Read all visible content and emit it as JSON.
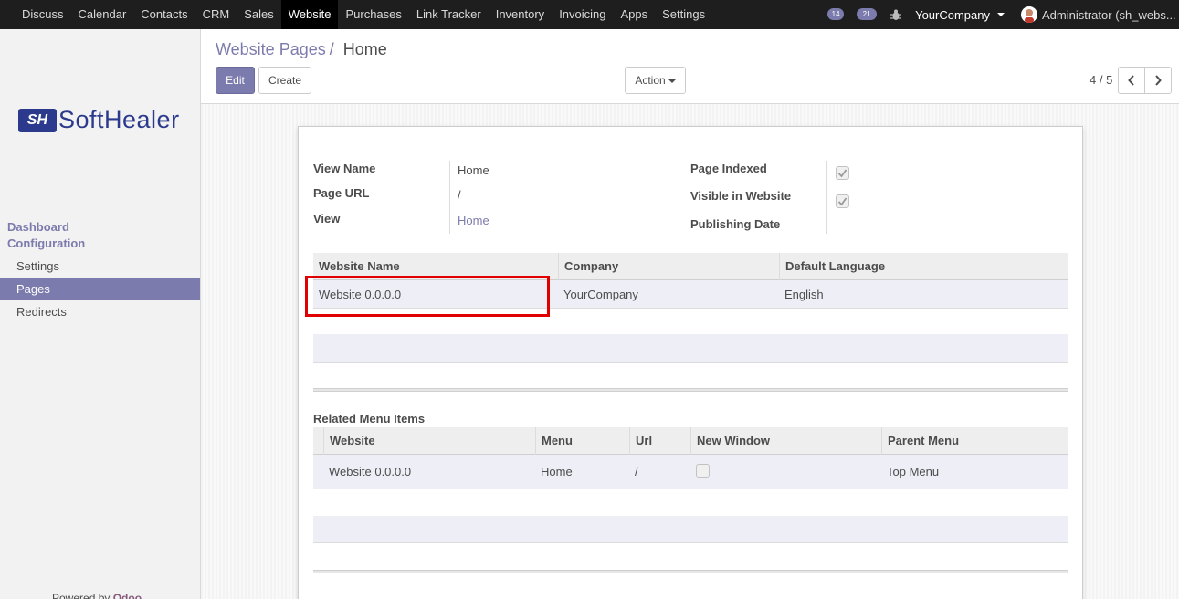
{
  "topbar": {
    "menu": [
      "Discuss",
      "Calendar",
      "Contacts",
      "CRM",
      "Sales",
      "Website",
      "Purchases",
      "Link Tracker",
      "Inventory",
      "Invoicing",
      "Apps",
      "Settings"
    ],
    "active_index": 5,
    "messages_count": "14",
    "activities_count": "21",
    "company": "YourCompany",
    "user": "Administrator (sh_webs..."
  },
  "sidebar": {
    "brand_mark": "SH",
    "brand_name": "SoftHealer",
    "sections": [
      "Dashboard",
      "Configuration"
    ],
    "items": [
      {
        "label": "Settings",
        "active": false
      },
      {
        "label": "Pages",
        "active": true
      },
      {
        "label": "Redirects",
        "active": false
      }
    ],
    "powered_prefix": "Powered by ",
    "powered_brand": "Odoo"
  },
  "control": {
    "breadcrumb_parent": "Website Pages",
    "breadcrumb_current": "Home",
    "edit_label": "Edit",
    "create_label": "Create",
    "action_label": "Action",
    "pager": "4 / 5"
  },
  "form": {
    "view_name_label": "View Name",
    "view_name": "Home",
    "page_url_label": "Page URL",
    "page_url": "/",
    "view_label": "View",
    "view": "Home",
    "page_indexed_label": "Page Indexed",
    "page_indexed": true,
    "visible_label": "Visible in Website",
    "visible": true,
    "publishing_date_label": "Publishing Date",
    "publishing_date": ""
  },
  "website_table": {
    "columns": [
      "Website Name",
      "Company",
      "Default Language"
    ],
    "rows": [
      [
        "Website 0.0.0.0",
        "YourCompany",
        "English"
      ]
    ]
  },
  "menu_table": {
    "title": "Related Menu Items",
    "columns": [
      "Website",
      "Menu",
      "Url",
      "New Window",
      "Parent Menu"
    ],
    "rows": [
      [
        "Website 0.0.0.0",
        "Home",
        "/",
        false,
        "Top Menu"
      ]
    ]
  }
}
